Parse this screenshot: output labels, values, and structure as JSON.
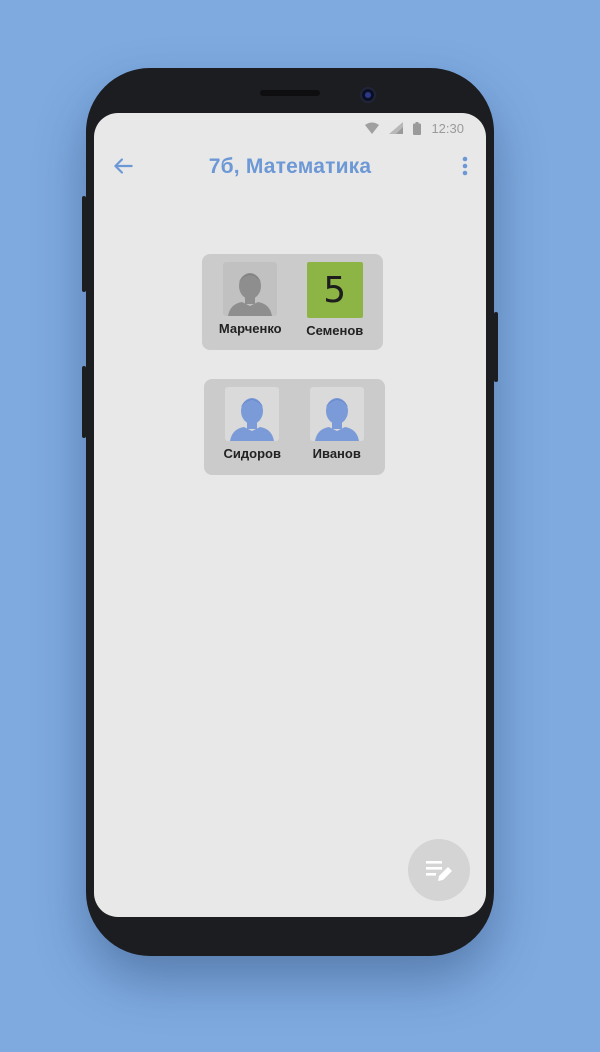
{
  "statusbar": {
    "time": "12:30",
    "icons": [
      "wifi-icon",
      "signal-icon",
      "battery-icon"
    ]
  },
  "appbar": {
    "title": "7б, Математика",
    "back_icon": "arrow-left-icon",
    "menu_icon": "more-vert-icon"
  },
  "desks": [
    {
      "students": [
        {
          "name": "Марченко",
          "status": "absent",
          "avatar": "person-icon",
          "grade": ""
        },
        {
          "name": "Семенов",
          "status": "graded",
          "avatar": "",
          "grade": "5"
        }
      ]
    },
    {
      "students": [
        {
          "name": "Сидоров",
          "status": "present",
          "avatar": "person-icon",
          "grade": ""
        },
        {
          "name": "Иванов",
          "status": "present",
          "avatar": "person-icon",
          "grade": ""
        }
      ]
    }
  ],
  "fab": {
    "icon": "edit-note-icon"
  },
  "colors": {
    "accent": "#6d98d6",
    "background": "#7eaae0",
    "grade_good": "#8db545",
    "avatar_absent": "#8e8e8e",
    "avatar_present": "#7b9bd8"
  }
}
